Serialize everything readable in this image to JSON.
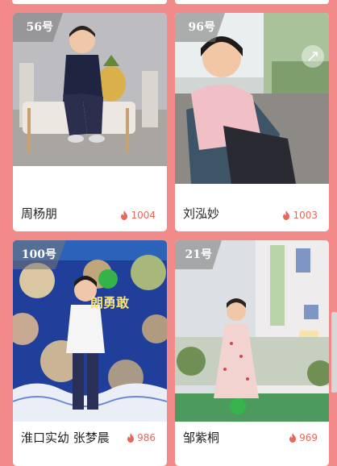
{
  "cards": [
    {
      "badge": "56号",
      "name": "周杨朋",
      "votes": "1004"
    },
    {
      "badge": "96号",
      "name": "刘泓妙",
      "votes": "1003"
    },
    {
      "badge": "100号",
      "name": "淮口实幼 张梦晨",
      "votes": "986"
    },
    {
      "badge": "21号",
      "name": "邹紫桐",
      "votes": "969"
    }
  ],
  "photo_wall_text": "朗勇敢",
  "icons": {
    "vote": "flame-icon",
    "share": "share-icon"
  },
  "colors": {
    "page_background": "#f28a8a",
    "card_background": "#ffffff",
    "vote_color": "#e8665a"
  }
}
